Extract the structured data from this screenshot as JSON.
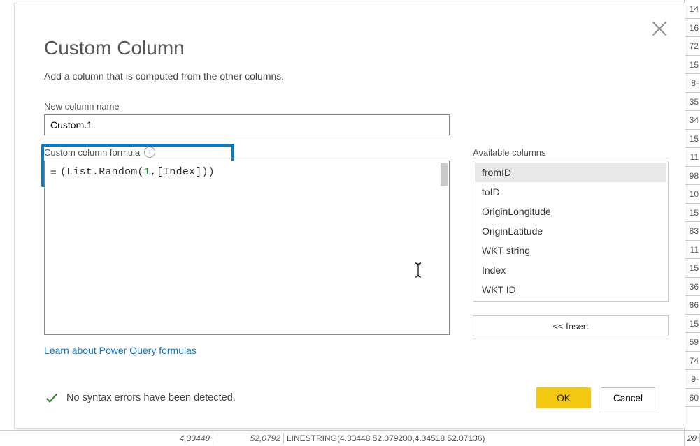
{
  "dialog": {
    "title": "Custom Column",
    "subtitle": "Add a column that is computed from the other columns.",
    "new_col_label": "New column name",
    "new_col_value": "Custom.1",
    "formula_label": "Custom column formula",
    "formula_prefix": "=",
    "formula_open": "(",
    "formula_fn": "List.Random",
    "formula_args_open": "(",
    "formula_num": "1",
    "formula_comma": ",",
    "formula_ref": "[Index]",
    "formula_args_close": ")",
    "formula_close": ")",
    "learn_link": "Learn about Power Query formulas",
    "avail_label": "Available columns",
    "avail_cols": [
      "fromID",
      "toID",
      "OriginLongitude",
      "OriginLatitude",
      "WKT string",
      "Index",
      "WKT ID"
    ],
    "insert_label": "<< Insert",
    "status_text": "No syntax errors have been detected.",
    "ok_label": "OK",
    "cancel_label": "Cancel"
  },
  "bg": {
    "right_col": [
      "14",
      "16",
      "72",
      "15",
      "8-",
      "35",
      "34",
      "15",
      "11",
      "98",
      "10",
      "15",
      "83",
      "11",
      "15",
      "36",
      "86",
      "15",
      "59",
      "74",
      "9-",
      "60"
    ],
    "bottom": {
      "c1": "4,33448",
      "c2": "52,0792",
      "c3": "LINESTRING(4.33448 52.079200,4.34518 52.07136)",
      "c4": "28"
    }
  }
}
